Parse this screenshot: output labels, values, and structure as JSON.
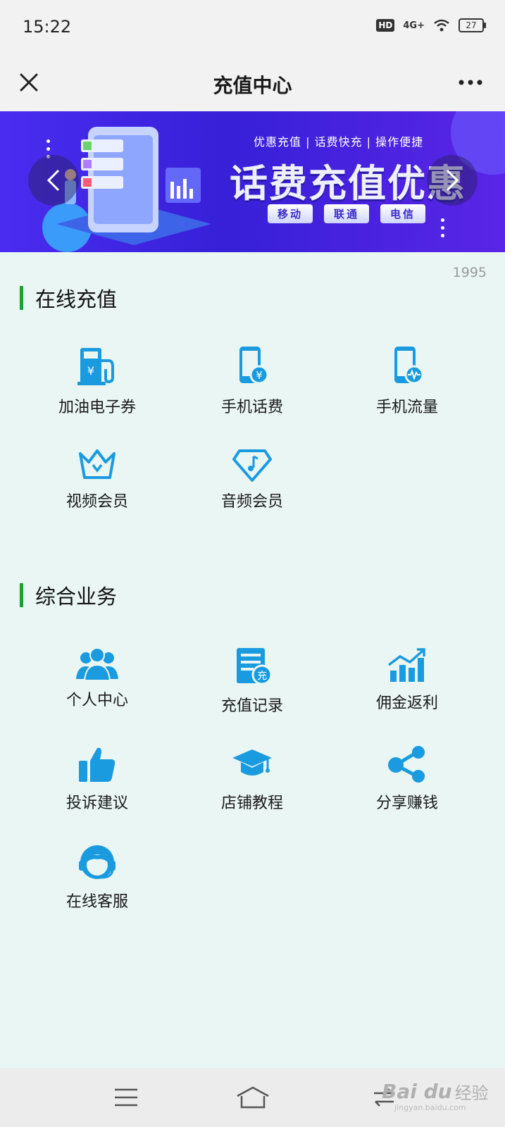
{
  "status": {
    "time": "15:22",
    "hd": "HD",
    "network": "4G+",
    "battery": "27"
  },
  "nav": {
    "title": "充值中心"
  },
  "banner": {
    "tagline": "优惠充值 | 话费快充 | 操作便捷",
    "headline": "话费充值优惠",
    "chips": [
      "移动",
      "联通",
      "电信"
    ]
  },
  "counter": "1995",
  "sections": {
    "online": {
      "title": "在线充值",
      "items": [
        "加油电子券",
        "手机话费",
        "手机流量",
        "视频会员",
        "音频会员"
      ]
    },
    "services": {
      "title": "综合业务",
      "items": [
        "个人中心",
        "充值记录",
        "佣金返利",
        "投诉建议",
        "店铺教程",
        "分享赚钱",
        "在线客服"
      ]
    }
  },
  "icons": {
    "fuel": "fuel-coupon-icon",
    "phone_bill": "phone-bill-icon",
    "phone_data": "phone-data-icon",
    "video": "crown-video-icon",
    "audio": "music-diamond-icon",
    "user": "users-icon",
    "records": "records-icon",
    "commission": "chart-up-icon",
    "complaint": "thumbs-up-icon",
    "tutorial": "graduation-cap-icon",
    "share": "share-icon",
    "service": "headset-icon"
  },
  "watermark": {
    "logo": "Bai du",
    "sub": "经验",
    "url": "jingyan.baidu.com"
  },
  "colors": {
    "accent": "#1e9e34",
    "icon": "#1a9be0",
    "background": "#e9f6f3"
  }
}
